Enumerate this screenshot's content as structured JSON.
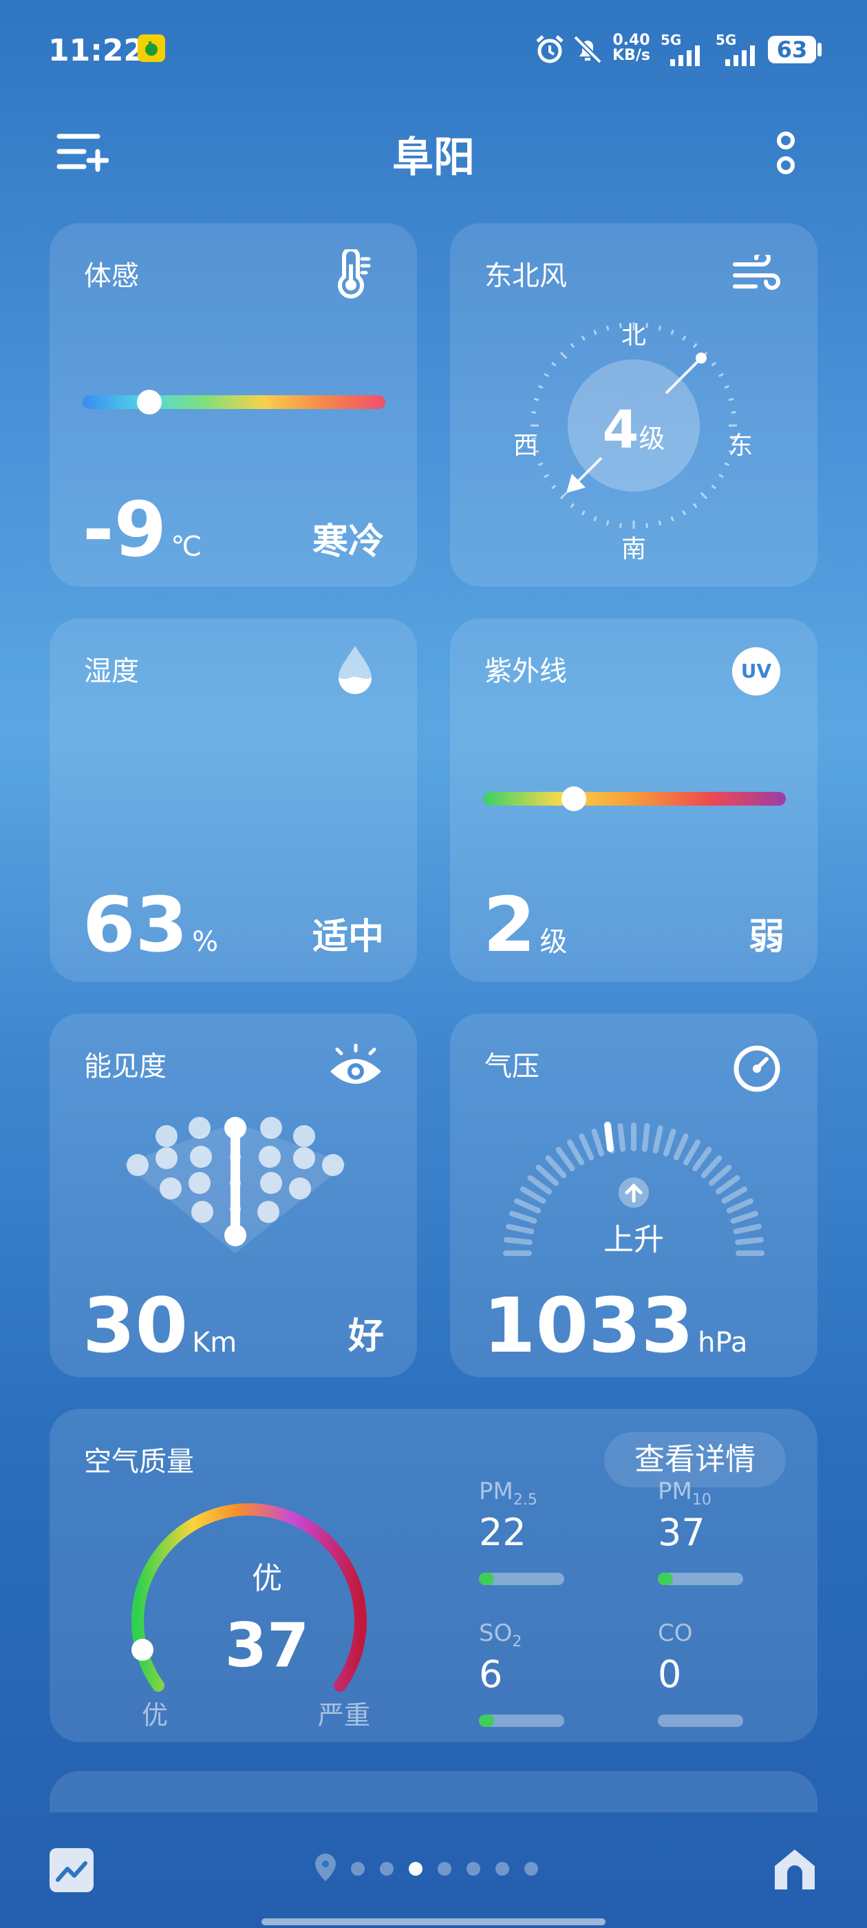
{
  "status_bar": {
    "time": "11:22",
    "net_speed_value": "0.40",
    "net_speed_unit": "KB/s",
    "signal1_label": "5G",
    "signal2_label": "5G",
    "battery": "63"
  },
  "header": {
    "city": "阜阳",
    "left_icon": "add-city-icon",
    "right_icon": "more-icon"
  },
  "feels_like": {
    "title": "体感",
    "value": "-9",
    "unit": "℃",
    "desc": "寒冷",
    "slider_fraction": 0.22
  },
  "wind": {
    "title": "东北风",
    "level": "4",
    "level_unit": "级",
    "north": "北",
    "south": "南",
    "west": "西",
    "east": "东"
  },
  "humidity": {
    "title": "湿度",
    "value": "63",
    "unit": "%",
    "desc": "适中"
  },
  "uv": {
    "title": "紫外线",
    "badge": "UV",
    "value": "2",
    "unit": "级",
    "desc": "弱",
    "slider_fraction": 0.3
  },
  "visibility": {
    "title": "能见度",
    "value": "30",
    "unit": "Km",
    "desc": "好"
  },
  "pressure": {
    "title": "气压",
    "trend": "上升",
    "value": "1033",
    "unit": "hPa"
  },
  "air_quality": {
    "title": "空气质量",
    "detail_button": "查看详情",
    "level": "优",
    "aqi": "37",
    "scale_min_label": "优",
    "scale_max_label": "严重",
    "pollutants": [
      {
        "name": "PM",
        "sub": "2.5",
        "value": "22",
        "fill": 0.18
      },
      {
        "name": "PM",
        "sub": "10",
        "value": "37",
        "fill": 0.18
      },
      {
        "name": "SO",
        "sub": "2",
        "value": "6",
        "fill": 0.18
      },
      {
        "name": "CO",
        "sub": "",
        "value": "0",
        "fill": 0.0
      }
    ]
  },
  "bottom_nav": {
    "left_icon": "trend-chart-icon",
    "right_icon": "home-icon",
    "page_count": 8,
    "active_page": 3
  }
}
